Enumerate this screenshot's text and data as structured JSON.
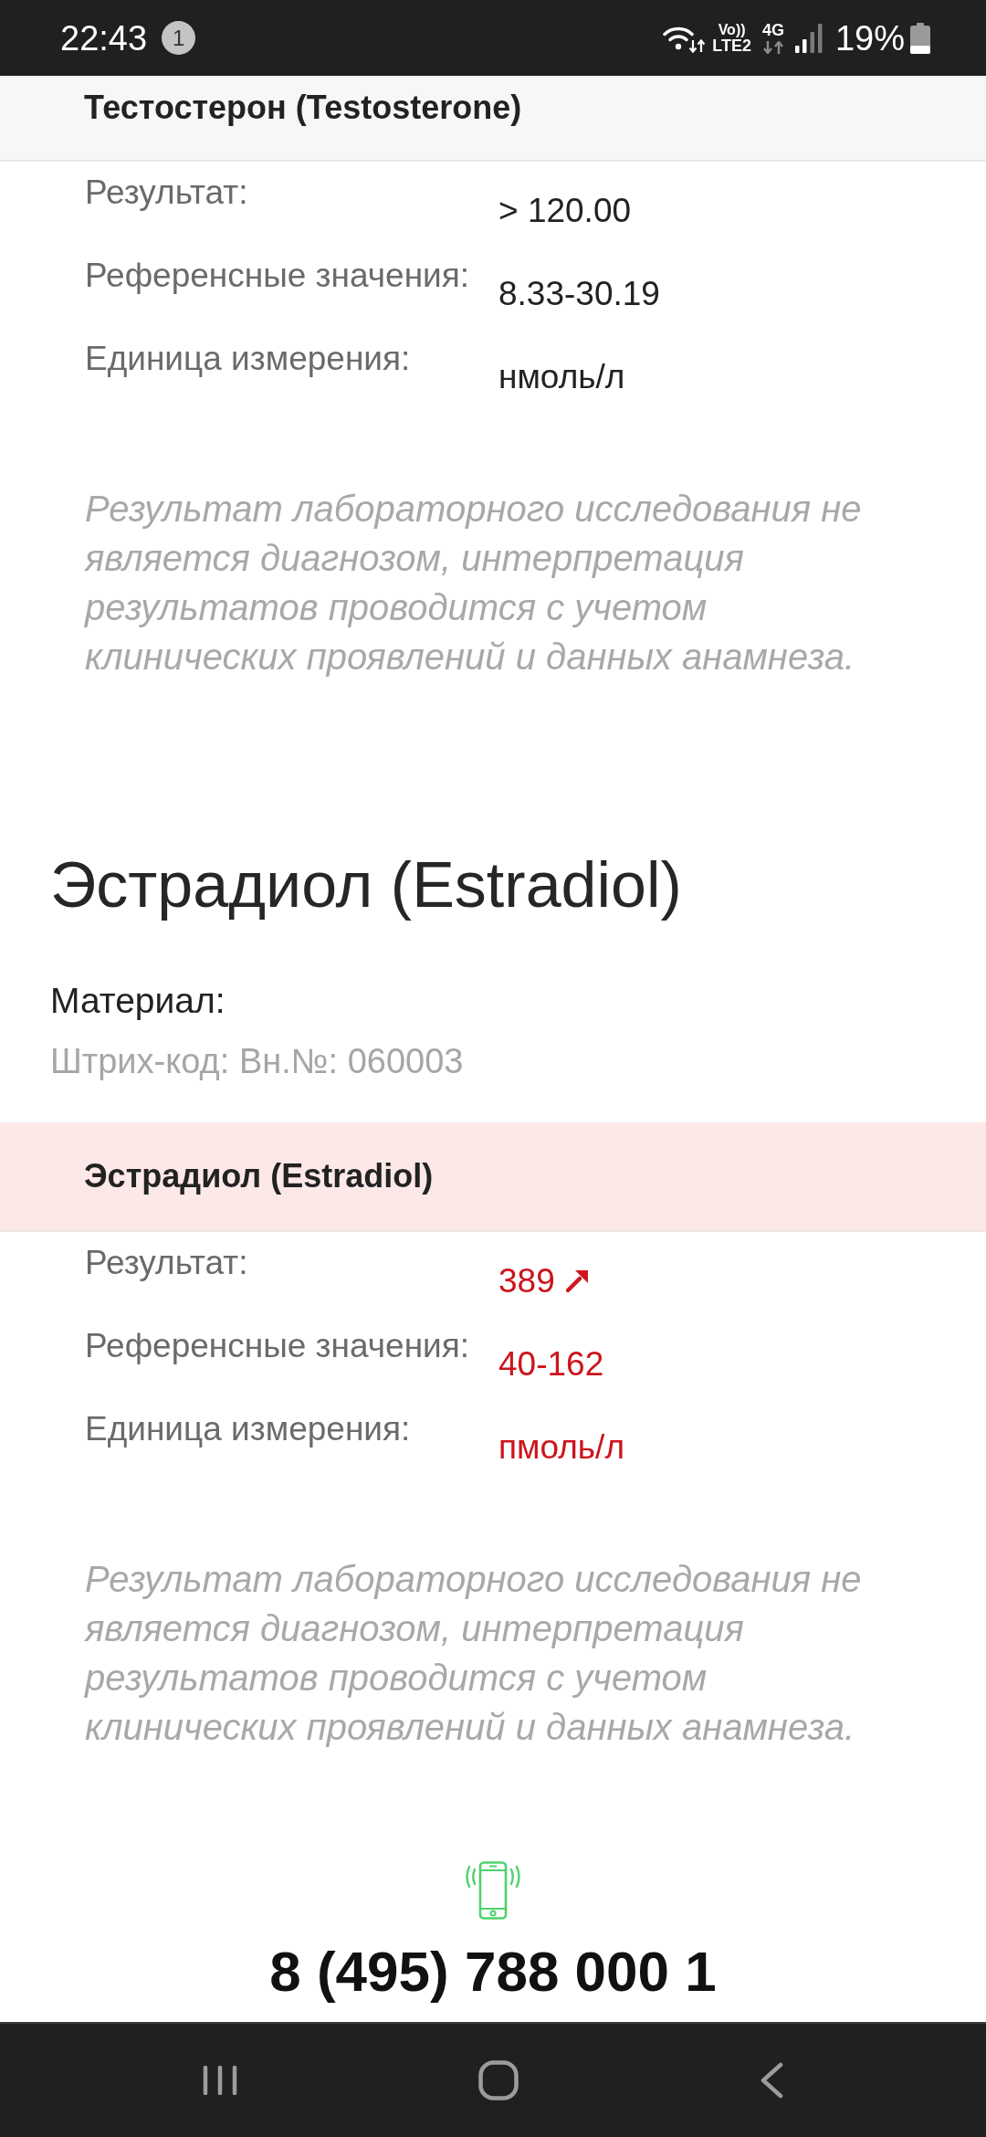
{
  "status_bar": {
    "time": "22:43",
    "notification_count": "1",
    "volte_label": "Vo))",
    "lte_label": "LTE2",
    "network_type": "4G",
    "battery_percent": "19%"
  },
  "sections": [
    {
      "result_header": {
        "title": "Тестостерон (Testosterone)",
        "abnormal": false
      },
      "rows": [
        {
          "label": "Результат:",
          "value": "> 120.00",
          "flag_up": false
        },
        {
          "label": "Референсные значения:",
          "value": "8.33-30.19",
          "flag_up": false
        },
        {
          "label": "Единица измерения:",
          "value": "нмоль/л",
          "flag_up": false
        }
      ],
      "disclaimer": "Результат лабораторного исследования не является диагнозом, интерпретация результатов проводится с учетом клинических проявлений и данных анамнеза."
    },
    {
      "title": "Эстрадиол (Estradiol)",
      "material_label": "Материал:",
      "barcode": "Штрих-код: Вн.№: 060003",
      "result_header": {
        "title": "Эстрадиол (Estradiol)",
        "abnormal": true
      },
      "rows": [
        {
          "label": "Результат:",
          "value": "389",
          "flag_up": true
        },
        {
          "label": "Референсные значения:",
          "value": "40-162",
          "flag_up": false
        },
        {
          "label": "Единица измерения:",
          "value": "пмоль/л",
          "flag_up": false
        }
      ],
      "disclaimer": "Результат лабораторного исследования не является диагнозом, интерпретация результатов проводится с учетом клинических проявлений и данных анамнеза."
    }
  ],
  "contact": {
    "phone": "8 (495) 788 000 1"
  }
}
